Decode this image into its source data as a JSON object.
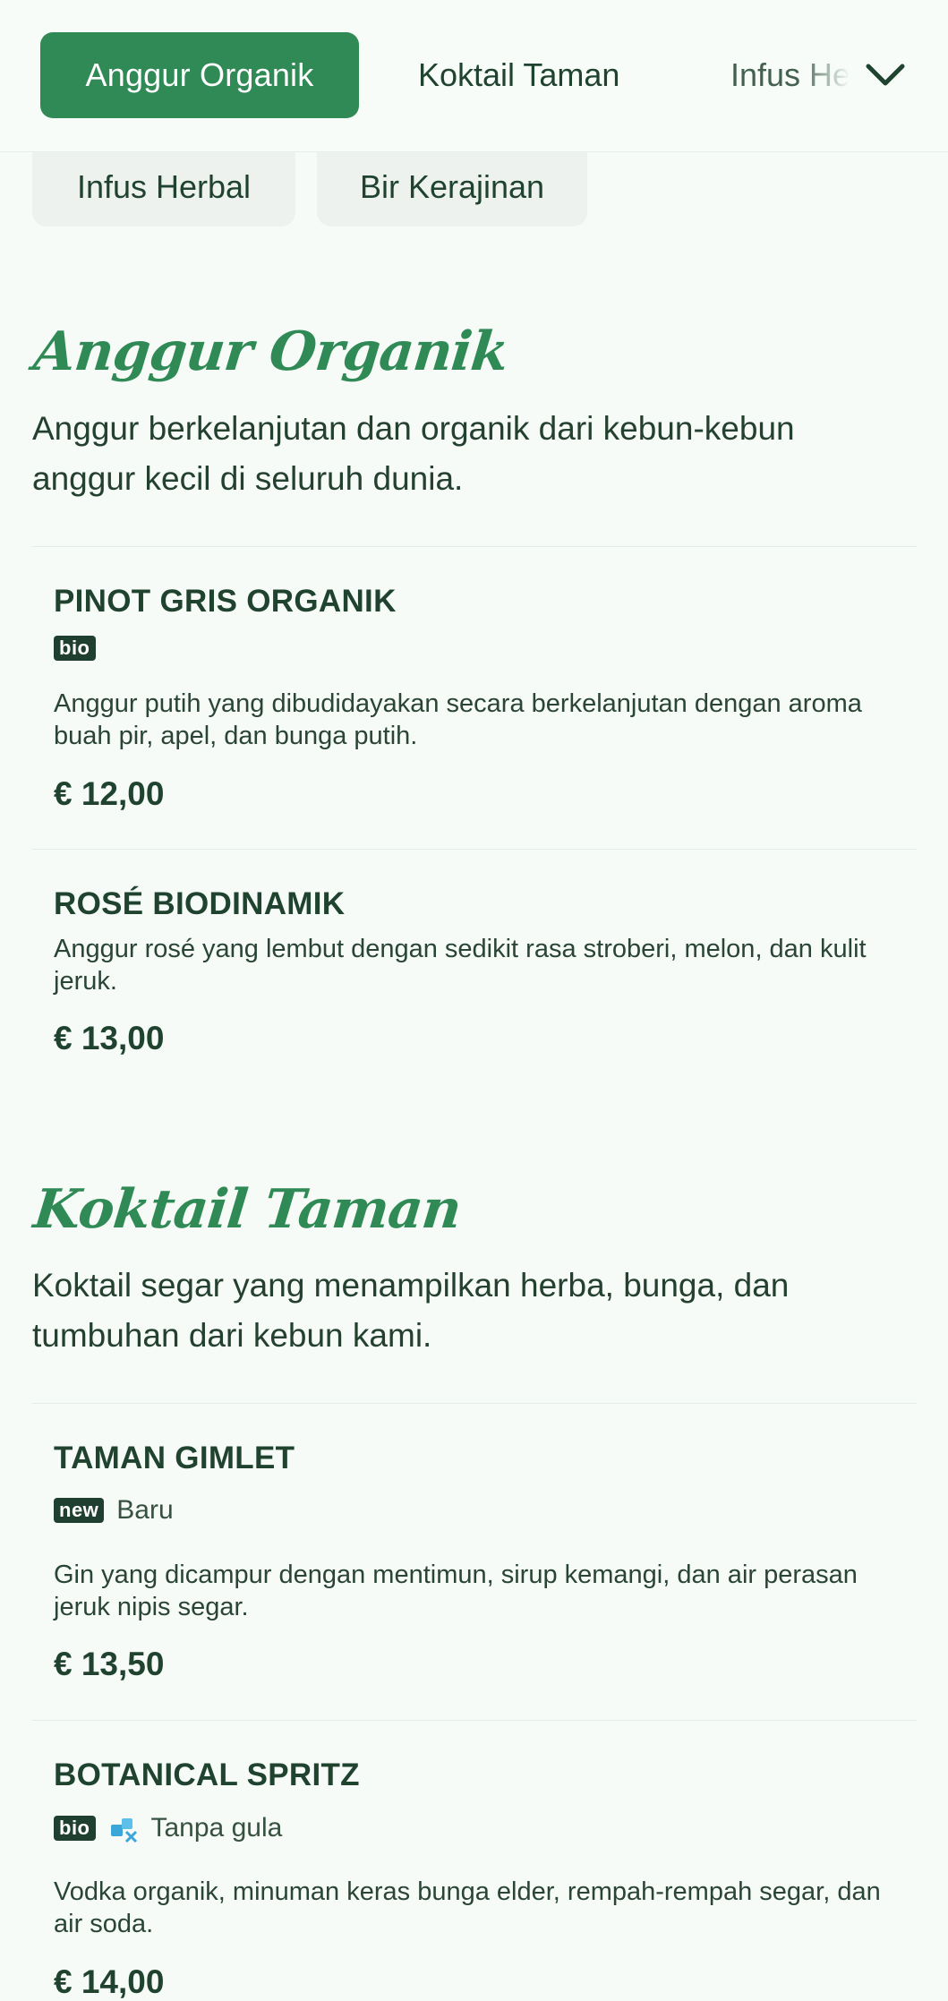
{
  "nav": {
    "tabs": [
      "Anggur Organik",
      "Koktail Taman",
      "Infus Herbal"
    ],
    "chips": [
      "Infus Herbal",
      "Bir Kerajinan"
    ]
  },
  "icons": {
    "expand": "chevron-down-icon",
    "sugar_free": "sugar-cubes-icon"
  },
  "colors": {
    "accent": "#2f8a55",
    "text": "#20432f",
    "badge": "#1f4030"
  },
  "sections": [
    {
      "title": "Anggur Organik",
      "description": "Anggur berkelanjutan dan organik dari kebun-kebun anggur kecil di seluruh dunia.",
      "items": [
        {
          "name": "PINOT GRIS ORGANIK",
          "badge": "bio",
          "description": "Anggur putih yang dibudidayakan secara berkelanjutan dengan aroma buah pir, apel, dan bunga putih.",
          "price": "€ 12,00"
        },
        {
          "name": "ROSÉ BIODINAMIK",
          "description": "Anggur rosé yang lembut dengan sedikit rasa stroberi, melon, dan kulit jeruk.",
          "price": "€ 13,00"
        }
      ]
    },
    {
      "title": "Koktail Taman",
      "description": "Koktail segar yang menampilkan herba, bunga, dan tumbuhan dari kebun kami.",
      "items": [
        {
          "name": "TAMAN GIMLET",
          "badge": "new",
          "tag_label": "Baru",
          "description": "Gin yang dicampur dengan mentimun, sirup kemangi, dan air perasan jeruk nipis segar.",
          "price": "€ 13,50"
        },
        {
          "name": "BOTANICAL SPRITZ",
          "badge": "bio",
          "tag_label": "Tanpa gula",
          "description": "Vodka organik, minuman keras bunga elder, rempah-rempah segar, dan air soda.",
          "price": "€ 14,00"
        }
      ]
    }
  ]
}
